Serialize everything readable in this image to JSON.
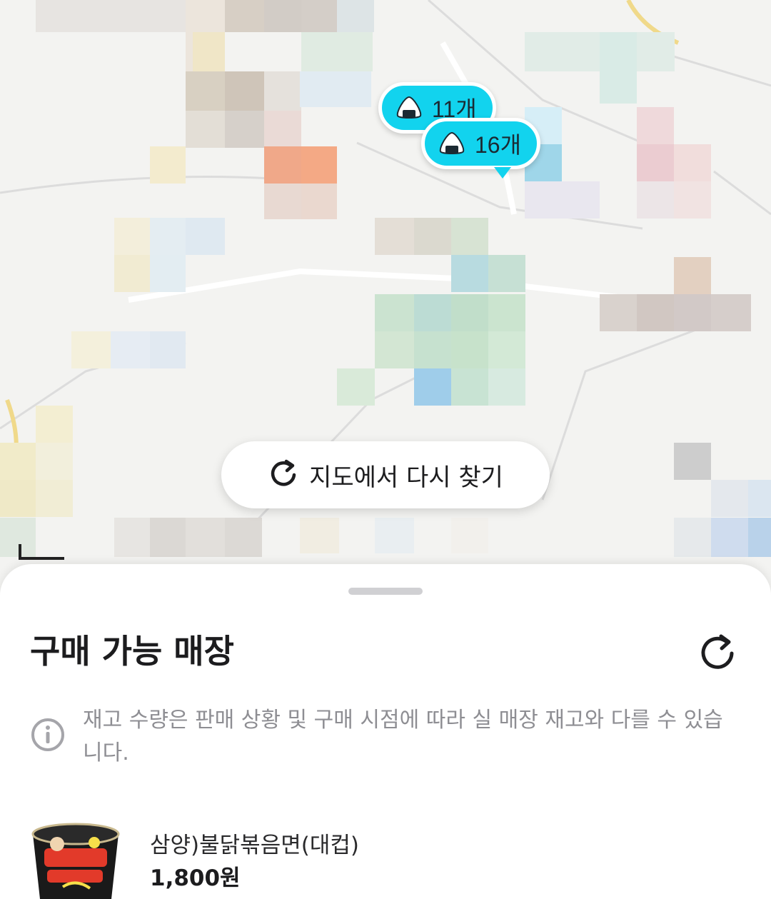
{
  "map": {
    "markers": [
      {
        "count_label": "11개",
        "icon": "rice-ball-icon"
      },
      {
        "count_label": "16개",
        "icon": "rice-ball-icon"
      }
    ],
    "research_button": {
      "label": "지도에서 다시 찾기",
      "icon": "refresh-icon"
    },
    "accent_color": "#12d3ee"
  },
  "sheet": {
    "title": "구매 가능 매장",
    "refresh_icon": "refresh-icon",
    "notice": {
      "icon": "info-icon",
      "text": "재고 수량은 판매 상황 및 구매 시점에 따라 실 매장 재고와 다를 수 있습니다."
    },
    "product": {
      "name": "삼양)불닭볶음면(대컵)",
      "price": "1,800원"
    }
  }
}
